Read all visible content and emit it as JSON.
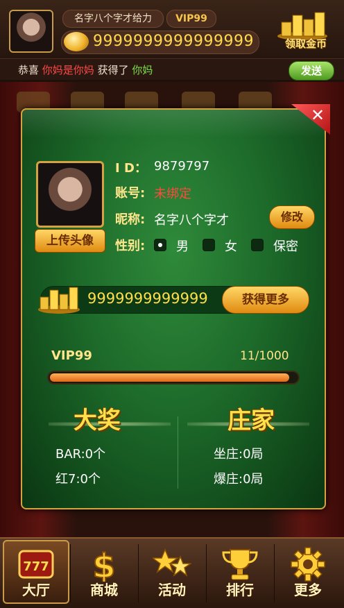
{
  "header": {
    "name_pill": "名字八个字才给力",
    "vip": "VIP99",
    "coins": "9999999999999999",
    "claim_gold_label": "领取金币",
    "ticker": {
      "prefix": "恭喜",
      "name": "你妈是你妈",
      "middle": "获得了",
      "item": "你妈"
    },
    "send_label": "发送"
  },
  "profile": {
    "upload_avatar_label": "上传头像",
    "id_label": "I D：",
    "id_value": "9879797",
    "account_label": "账号:",
    "account_value": "未绑定",
    "nickname_label": "昵称:",
    "nickname_value": "名字八个字才",
    "edit_label": "修改",
    "gender_label": "性别:",
    "gender_options": [
      "男",
      "女",
      "保密"
    ],
    "gender_selected": "男"
  },
  "gold": {
    "amount": "9999999999999",
    "get_more_label": "获得更多"
  },
  "vip": {
    "level": "VIP99",
    "progress_text": "11/1000",
    "progress_fraction": 0.97
  },
  "stats": {
    "jackpot_title": "大奖",
    "banker_title": "庄家",
    "bar": "BAR:0个",
    "red7": "红7:0个",
    "sit_banker": "坐庄:0局",
    "burst_banker": "爆庄:0局"
  },
  "nav": [
    {
      "label": "大厅",
      "icon": "slot-777-icon",
      "active": true
    },
    {
      "label": "商城",
      "icon": "dollar-sign-icon",
      "active": false
    },
    {
      "label": "活动",
      "icon": "stars-icon",
      "active": false
    },
    {
      "label": "排行",
      "icon": "trophy-icon",
      "active": false
    },
    {
      "label": "更多",
      "icon": "gear-icon",
      "active": false
    }
  ],
  "colors": {
    "panel_green": "#1d6a2a",
    "gold": "#ffde4a",
    "border_gold": "#d5a440",
    "close_red": "#d01e1e"
  }
}
